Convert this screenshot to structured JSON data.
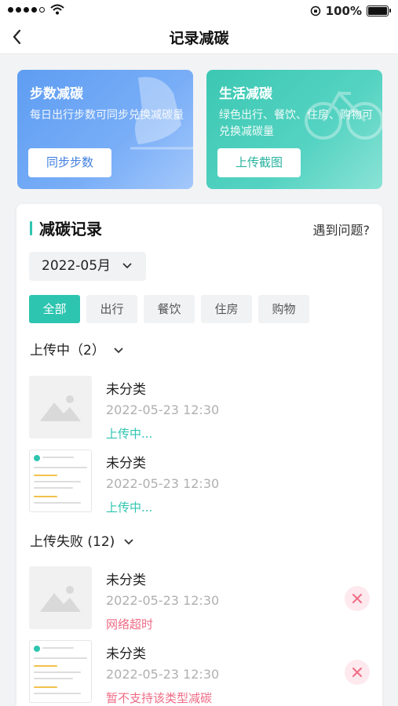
{
  "status_bar": {
    "battery": "100%"
  },
  "nav": {
    "title": "记录减碳"
  },
  "cards": [
    {
      "title": "步数减碳",
      "desc": "每日出行步数可同步兑换减碳量",
      "button": "同步步数"
    },
    {
      "title": "生活减碳",
      "desc": "绿色出行、餐饮、住房、购物可兑换减碳量",
      "button": "上传截图"
    }
  ],
  "records": {
    "title": "减碳记录",
    "help": "遇到问题?",
    "month": "2022-05月",
    "filters": [
      "全部",
      "出行",
      "餐饮",
      "住房",
      "购物"
    ],
    "uploading": {
      "header": "上传中（2）",
      "items": [
        {
          "name": "未分类",
          "date": "2022-05-23 12:30",
          "status": "上传中..."
        },
        {
          "name": "未分类",
          "date": "2022-05-23 12:30",
          "status": "上传中..."
        }
      ]
    },
    "failed": {
      "header": "上传失败 (12)",
      "items": [
        {
          "name": "未分类",
          "date": "2022-05-23 12:30",
          "status": "网络超时"
        },
        {
          "name": "未分类",
          "date": "2022-05-23 12:30",
          "status": "暂不支持该类型减碳"
        }
      ]
    }
  },
  "colors": {
    "accent": "#2ec5b0",
    "error": "#f06b85",
    "blue_card": "#5e9df2",
    "green_card": "#3cc8b3"
  }
}
